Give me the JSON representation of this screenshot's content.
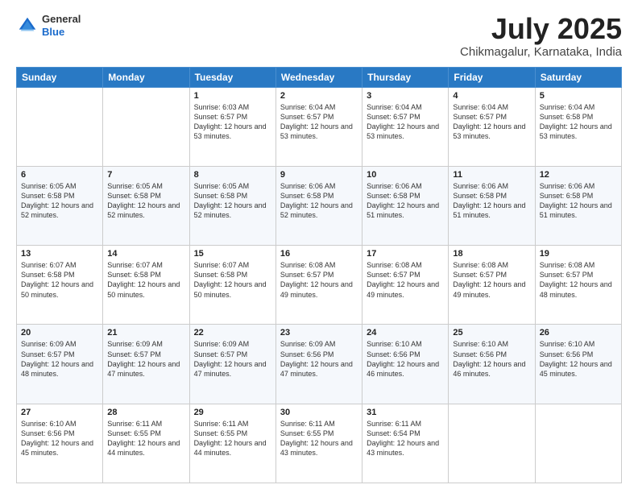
{
  "header": {
    "logo_general": "General",
    "logo_blue": "Blue",
    "month": "July 2025",
    "location": "Chikmagalur, Karnataka, India"
  },
  "weekdays": [
    "Sunday",
    "Monday",
    "Tuesday",
    "Wednesday",
    "Thursday",
    "Friday",
    "Saturday"
  ],
  "weeks": [
    [
      {
        "day": "",
        "sunrise": "",
        "sunset": "",
        "daylight": ""
      },
      {
        "day": "",
        "sunrise": "",
        "sunset": "",
        "daylight": ""
      },
      {
        "day": "1",
        "sunrise": "Sunrise: 6:03 AM",
        "sunset": "Sunset: 6:57 PM",
        "daylight": "Daylight: 12 hours and 53 minutes."
      },
      {
        "day": "2",
        "sunrise": "Sunrise: 6:04 AM",
        "sunset": "Sunset: 6:57 PM",
        "daylight": "Daylight: 12 hours and 53 minutes."
      },
      {
        "day": "3",
        "sunrise": "Sunrise: 6:04 AM",
        "sunset": "Sunset: 6:57 PM",
        "daylight": "Daylight: 12 hours and 53 minutes."
      },
      {
        "day": "4",
        "sunrise": "Sunrise: 6:04 AM",
        "sunset": "Sunset: 6:57 PM",
        "daylight": "Daylight: 12 hours and 53 minutes."
      },
      {
        "day": "5",
        "sunrise": "Sunrise: 6:04 AM",
        "sunset": "Sunset: 6:58 PM",
        "daylight": "Daylight: 12 hours and 53 minutes."
      }
    ],
    [
      {
        "day": "6",
        "sunrise": "Sunrise: 6:05 AM",
        "sunset": "Sunset: 6:58 PM",
        "daylight": "Daylight: 12 hours and 52 minutes."
      },
      {
        "day": "7",
        "sunrise": "Sunrise: 6:05 AM",
        "sunset": "Sunset: 6:58 PM",
        "daylight": "Daylight: 12 hours and 52 minutes."
      },
      {
        "day": "8",
        "sunrise": "Sunrise: 6:05 AM",
        "sunset": "Sunset: 6:58 PM",
        "daylight": "Daylight: 12 hours and 52 minutes."
      },
      {
        "day": "9",
        "sunrise": "Sunrise: 6:06 AM",
        "sunset": "Sunset: 6:58 PM",
        "daylight": "Daylight: 12 hours and 52 minutes."
      },
      {
        "day": "10",
        "sunrise": "Sunrise: 6:06 AM",
        "sunset": "Sunset: 6:58 PM",
        "daylight": "Daylight: 12 hours and 51 minutes."
      },
      {
        "day": "11",
        "sunrise": "Sunrise: 6:06 AM",
        "sunset": "Sunset: 6:58 PM",
        "daylight": "Daylight: 12 hours and 51 minutes."
      },
      {
        "day": "12",
        "sunrise": "Sunrise: 6:06 AM",
        "sunset": "Sunset: 6:58 PM",
        "daylight": "Daylight: 12 hours and 51 minutes."
      }
    ],
    [
      {
        "day": "13",
        "sunrise": "Sunrise: 6:07 AM",
        "sunset": "Sunset: 6:58 PM",
        "daylight": "Daylight: 12 hours and 50 minutes."
      },
      {
        "day": "14",
        "sunrise": "Sunrise: 6:07 AM",
        "sunset": "Sunset: 6:58 PM",
        "daylight": "Daylight: 12 hours and 50 minutes."
      },
      {
        "day": "15",
        "sunrise": "Sunrise: 6:07 AM",
        "sunset": "Sunset: 6:58 PM",
        "daylight": "Daylight: 12 hours and 50 minutes."
      },
      {
        "day": "16",
        "sunrise": "Sunrise: 6:08 AM",
        "sunset": "Sunset: 6:57 PM",
        "daylight": "Daylight: 12 hours and 49 minutes."
      },
      {
        "day": "17",
        "sunrise": "Sunrise: 6:08 AM",
        "sunset": "Sunset: 6:57 PM",
        "daylight": "Daylight: 12 hours and 49 minutes."
      },
      {
        "day": "18",
        "sunrise": "Sunrise: 6:08 AM",
        "sunset": "Sunset: 6:57 PM",
        "daylight": "Daylight: 12 hours and 49 minutes."
      },
      {
        "day": "19",
        "sunrise": "Sunrise: 6:08 AM",
        "sunset": "Sunset: 6:57 PM",
        "daylight": "Daylight: 12 hours and 48 minutes."
      }
    ],
    [
      {
        "day": "20",
        "sunrise": "Sunrise: 6:09 AM",
        "sunset": "Sunset: 6:57 PM",
        "daylight": "Daylight: 12 hours and 48 minutes."
      },
      {
        "day": "21",
        "sunrise": "Sunrise: 6:09 AM",
        "sunset": "Sunset: 6:57 PM",
        "daylight": "Daylight: 12 hours and 47 minutes."
      },
      {
        "day": "22",
        "sunrise": "Sunrise: 6:09 AM",
        "sunset": "Sunset: 6:57 PM",
        "daylight": "Daylight: 12 hours and 47 minutes."
      },
      {
        "day": "23",
        "sunrise": "Sunrise: 6:09 AM",
        "sunset": "Sunset: 6:56 PM",
        "daylight": "Daylight: 12 hours and 47 minutes."
      },
      {
        "day": "24",
        "sunrise": "Sunrise: 6:10 AM",
        "sunset": "Sunset: 6:56 PM",
        "daylight": "Daylight: 12 hours and 46 minutes."
      },
      {
        "day": "25",
        "sunrise": "Sunrise: 6:10 AM",
        "sunset": "Sunset: 6:56 PM",
        "daylight": "Daylight: 12 hours and 46 minutes."
      },
      {
        "day": "26",
        "sunrise": "Sunrise: 6:10 AM",
        "sunset": "Sunset: 6:56 PM",
        "daylight": "Daylight: 12 hours and 45 minutes."
      }
    ],
    [
      {
        "day": "27",
        "sunrise": "Sunrise: 6:10 AM",
        "sunset": "Sunset: 6:56 PM",
        "daylight": "Daylight: 12 hours and 45 minutes."
      },
      {
        "day": "28",
        "sunrise": "Sunrise: 6:11 AM",
        "sunset": "Sunset: 6:55 PM",
        "daylight": "Daylight: 12 hours and 44 minutes."
      },
      {
        "day": "29",
        "sunrise": "Sunrise: 6:11 AM",
        "sunset": "Sunset: 6:55 PM",
        "daylight": "Daylight: 12 hours and 44 minutes."
      },
      {
        "day": "30",
        "sunrise": "Sunrise: 6:11 AM",
        "sunset": "Sunset: 6:55 PM",
        "daylight": "Daylight: 12 hours and 43 minutes."
      },
      {
        "day": "31",
        "sunrise": "Sunrise: 6:11 AM",
        "sunset": "Sunset: 6:54 PM",
        "daylight": "Daylight: 12 hours and 43 minutes."
      },
      {
        "day": "",
        "sunrise": "",
        "sunset": "",
        "daylight": ""
      },
      {
        "day": "",
        "sunrise": "",
        "sunset": "",
        "daylight": ""
      }
    ]
  ]
}
